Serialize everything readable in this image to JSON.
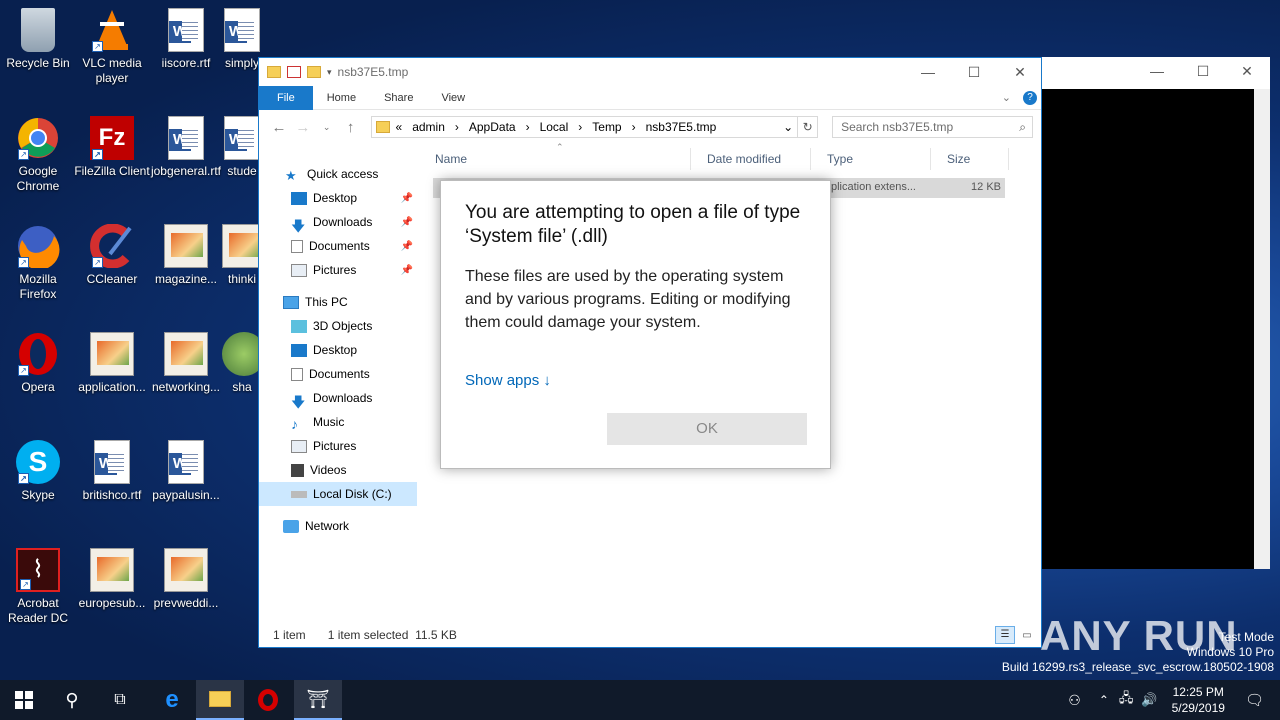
{
  "desktop": {
    "icons": [
      {
        "label": "Recycle Bin",
        "icon": "recycle-bin-icon"
      },
      {
        "label": "VLC media player",
        "icon": "vlc-icon"
      },
      {
        "label": "iiscore.rtf",
        "icon": "word-doc-icon"
      },
      {
        "label": "simply",
        "icon": "word-doc-icon"
      },
      {
        "label": "Google Chrome",
        "icon": "chrome-icon"
      },
      {
        "label": "FileZilla Client",
        "icon": "filezilla-icon"
      },
      {
        "label": "jobgeneral.rtf",
        "icon": "word-doc-icon"
      },
      {
        "label": "stude",
        "icon": "word-doc-icon"
      },
      {
        "label": "Mozilla Firefox",
        "icon": "firefox-icon"
      },
      {
        "label": "CCleaner",
        "icon": "ccleaner-icon"
      },
      {
        "label": "magazine...",
        "icon": "image-file-icon"
      },
      {
        "label": "thinki",
        "icon": "image-file-icon"
      },
      {
        "label": "Opera",
        "icon": "opera-icon"
      },
      {
        "label": "application...",
        "icon": "image-file-icon"
      },
      {
        "label": "networking...",
        "icon": "image-file-icon"
      },
      {
        "label": "sha",
        "icon": "globe-file-icon"
      },
      {
        "label": "Skype",
        "icon": "skype-icon"
      },
      {
        "label": "britishco.rtf",
        "icon": "word-doc-icon"
      },
      {
        "label": "paypalusin...",
        "icon": "word-doc-icon"
      },
      {
        "label": "Acrobat Reader DC",
        "icon": "acrobat-icon"
      },
      {
        "label": "europesub...",
        "icon": "image-file-icon"
      },
      {
        "label": "prevweddi...",
        "icon": "image-file-icon"
      }
    ]
  },
  "explorer": {
    "title": "nsb37E5.tmp",
    "ribbon_tabs": [
      "File",
      "Home",
      "Share",
      "View"
    ],
    "breadcrumb": [
      "«",
      "admin",
      "AppData",
      "Local",
      "Temp",
      "nsb37E5.tmp"
    ],
    "search_placeholder": "Search nsb37E5.tmp",
    "nav": {
      "quick_access": "Quick access",
      "qa_items": [
        "Desktop",
        "Downloads",
        "Documents",
        "Pictures"
      ],
      "this_pc": "This PC",
      "pc_items": [
        "3D Objects",
        "Desktop",
        "Documents",
        "Downloads",
        "Music",
        "Pictures",
        "Videos",
        "Local Disk (C:)"
      ],
      "network": "Network"
    },
    "columns": [
      "Name",
      "Date modified",
      "Type",
      "Size"
    ],
    "file": {
      "type": "plication extens...",
      "size": "12 KB"
    },
    "status": {
      "count": "1 item",
      "selected": "1 item selected  11.5 KB"
    }
  },
  "dialog": {
    "title": "You are attempting to open a file of type ‘System file’ (.dll)",
    "body": "These files are used by the operating system and by various programs. Editing or modifying them could damage your system.",
    "link": "Show apps ↓",
    "ok": "OK"
  },
  "watermark": "ANY RUN",
  "windows_info": {
    "line1": "Test Mode",
    "line2": "Windows 10 Pro",
    "line3": "Build 16299.rs3_release_svc_escrow.180502-1908"
  },
  "taskbar": {
    "time": "12:25 PM",
    "date": "5/29/2019"
  }
}
